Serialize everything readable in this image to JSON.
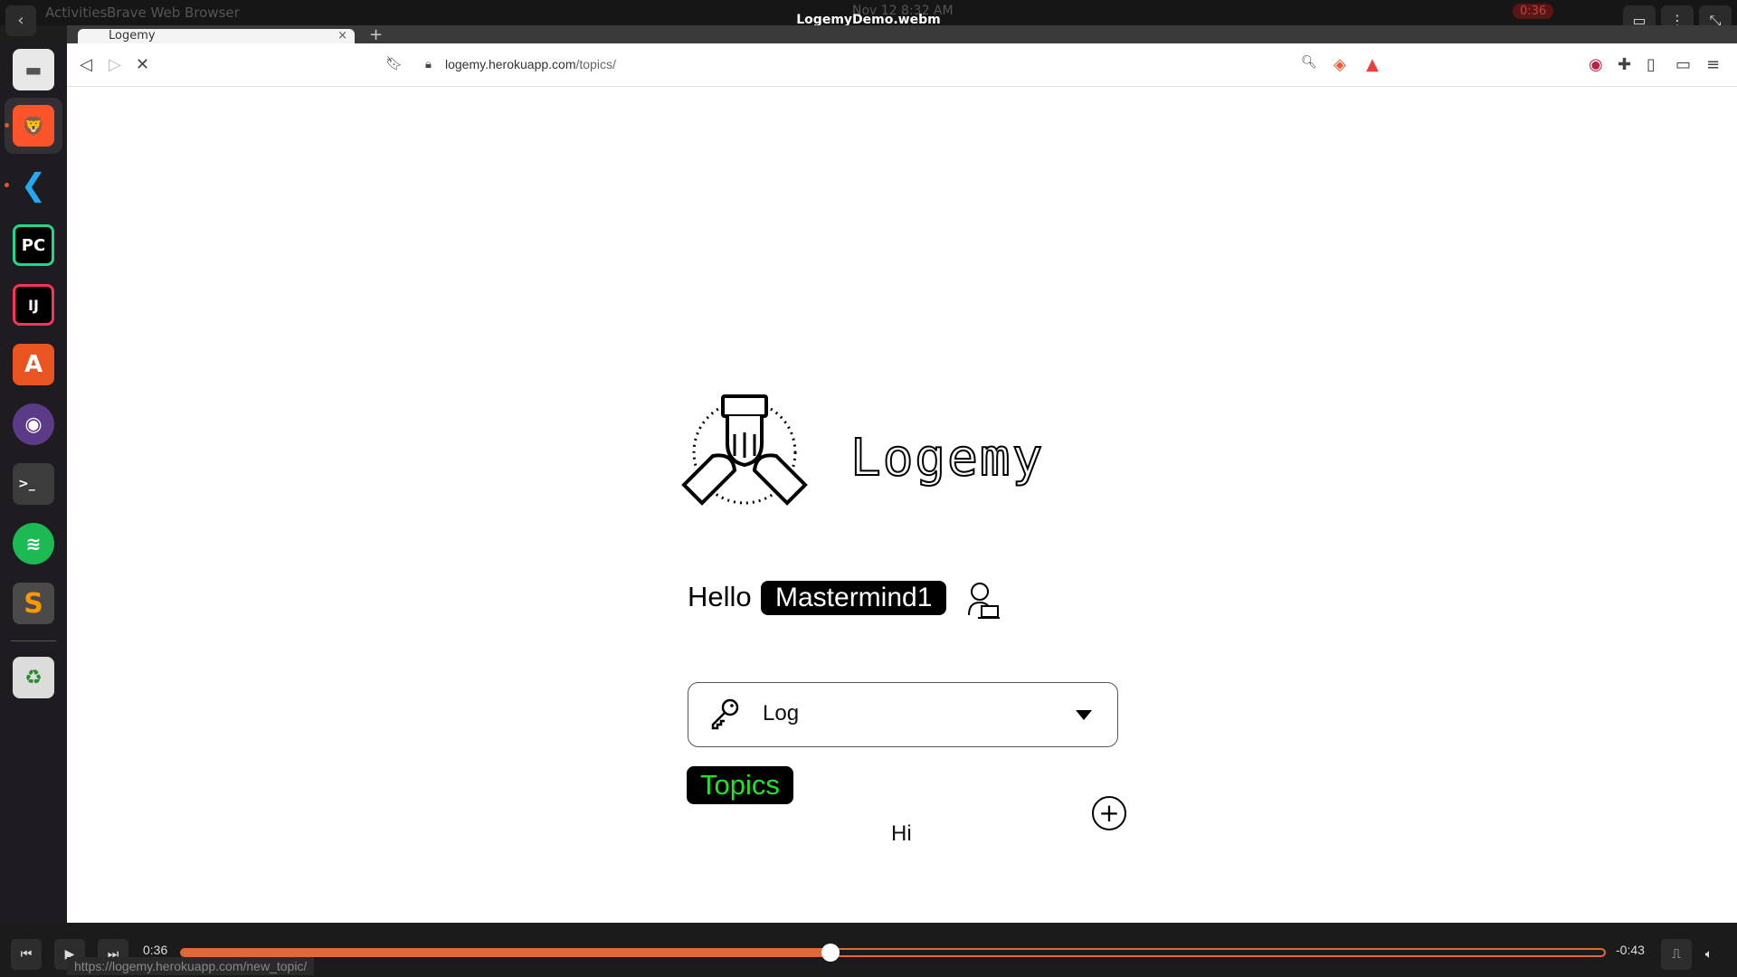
{
  "os": {
    "activities_label": "Activities",
    "app_name": "Brave Web Browser",
    "clock": "Nov 12  8:32 AM",
    "video_title": "LogemyDemo.webm",
    "recording_time": "0:36"
  },
  "browser": {
    "tab_title": "Logemy",
    "url_host": "logemy.herokuapp.com",
    "url_path": "/topics/",
    "status_url": "https://logemy.herokuapp.com/new_topic/"
  },
  "page": {
    "brand": "Logemy",
    "greeting": "Hello",
    "username": "Mastermind1",
    "dropdown_value": "Log",
    "topics_label": "Topics",
    "add_symbol": "+",
    "topic_item": "Hi"
  },
  "player": {
    "elapsed": "0:36",
    "remaining": "-0:43",
    "progress_fraction": 0.456
  },
  "colors": {
    "accent_green": "#22e32a",
    "progress": "#e0693a"
  }
}
